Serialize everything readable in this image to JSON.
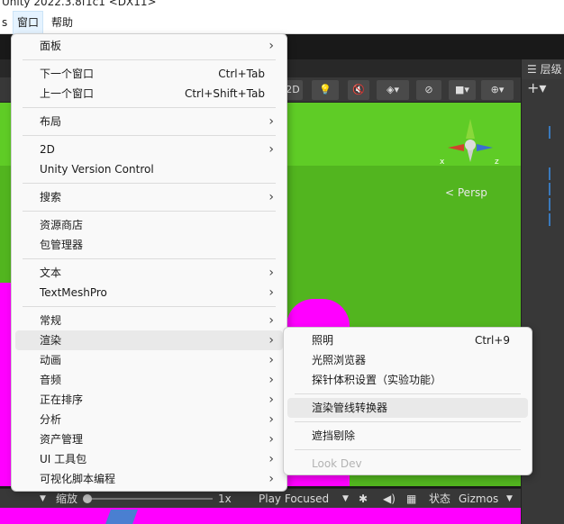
{
  "window": {
    "title": "Unity 2022.3.8f1c1 <DX11>"
  },
  "menubar": {
    "items": [
      "s",
      "窗口",
      "帮助"
    ]
  },
  "window_menu": {
    "groups": [
      [
        {
          "label": "面板",
          "submenu": true
        }
      ],
      [
        {
          "label": "下一个窗口",
          "shortcut": "Ctrl+Tab"
        },
        {
          "label": "上一个窗口",
          "shortcut": "Ctrl+Shift+Tab"
        }
      ],
      [
        {
          "label": "布局",
          "submenu": true
        }
      ],
      [
        {
          "label": "2D",
          "submenu": true
        },
        {
          "label": "Unity Version Control"
        }
      ],
      [
        {
          "label": "搜索",
          "submenu": true
        }
      ],
      [
        {
          "label": "资源商店"
        },
        {
          "label": "包管理器"
        }
      ],
      [
        {
          "label": "文本",
          "submenu": true
        },
        {
          "label": "TextMeshPro",
          "submenu": true
        }
      ],
      [
        {
          "label": "常规",
          "submenu": true
        },
        {
          "label": "渲染",
          "submenu": true,
          "highlighted": true
        },
        {
          "label": "动画",
          "submenu": true
        },
        {
          "label": "音频",
          "submenu": true
        },
        {
          "label": "正在排序",
          "submenu": true
        },
        {
          "label": "分析",
          "submenu": true
        },
        {
          "label": "资产管理",
          "submenu": true
        },
        {
          "label": "UI 工具包",
          "submenu": true
        },
        {
          "label": "可视化脚本编程",
          "submenu": true
        }
      ]
    ]
  },
  "render_submenu": {
    "groups": [
      [
        {
          "label": "照明",
          "shortcut": "Ctrl+9"
        },
        {
          "label": "光照浏览器"
        },
        {
          "label": "探针体积设置（实验功能）"
        }
      ],
      [
        {
          "label": "渲染管线转换器",
          "highlighted": true
        }
      ],
      [
        {
          "label": "遮挡剔除"
        }
      ],
      [
        {
          "label": "Look Dev",
          "disabled": true
        }
      ]
    ]
  },
  "scene": {
    "toolbar_2d": "2D",
    "persp_label": "Persp",
    "gizmo_axes": {
      "x": "x",
      "z": "z"
    }
  },
  "bottom_bar": {
    "zoom_label": "缩放",
    "zoom_value": "1x",
    "play_mode": "Play Focused",
    "status_label": "状态",
    "gizmos_label": "Gizmos"
  },
  "hierarchy": {
    "tab_label": "层级"
  },
  "colors": {
    "scene_green": "#5fcc26",
    "magenta": "#ff00ff",
    "menu_bg": "#f9f9f9",
    "editor_dark": "#383838"
  }
}
